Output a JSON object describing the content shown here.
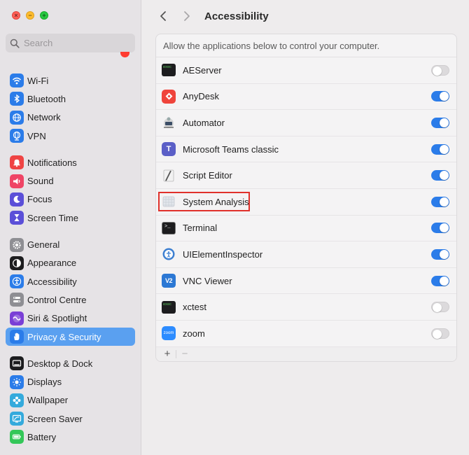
{
  "window": {
    "controls": [
      "×",
      "−",
      "+"
    ]
  },
  "sidebar": {
    "search_placeholder": "Search",
    "groups": [
      [
        {
          "label": "Wi-Fi",
          "icon": "wifi-icon",
          "color": "#2b7ce9"
        },
        {
          "label": "Bluetooth",
          "icon": "bluetooth-icon",
          "color": "#2b7ce9"
        },
        {
          "label": "Network",
          "icon": "globe-icon",
          "color": "#2b7ce9"
        },
        {
          "label": "VPN",
          "icon": "vpn-globe-icon",
          "color": "#2b7ce9"
        }
      ],
      [
        {
          "label": "Notifications",
          "icon": "bell-icon",
          "color": "#ef4444"
        },
        {
          "label": "Sound",
          "icon": "speaker-icon",
          "color": "#ef4465"
        },
        {
          "label": "Focus",
          "icon": "moon-icon",
          "color": "#5b4fd8"
        },
        {
          "label": "Screen Time",
          "icon": "hourglass-icon",
          "color": "#5b4fd8"
        }
      ],
      [
        {
          "label": "General",
          "icon": "gear-icon",
          "color": "#8e8e93"
        },
        {
          "label": "Appearance",
          "icon": "appearance-icon",
          "color": "#1c1c1e"
        },
        {
          "label": "Accessibility",
          "icon": "accessibility-icon",
          "color": "#2b7ce9"
        },
        {
          "label": "Control Centre",
          "icon": "control-centre-icon",
          "color": "#8e8e93"
        },
        {
          "label": "Siri & Spotlight",
          "icon": "siri-icon",
          "color": "#7a3fd6"
        },
        {
          "label": "Privacy & Security",
          "icon": "hand-icon",
          "color": "#2b7ce9",
          "selected": true
        }
      ],
      [
        {
          "label": "Desktop & Dock",
          "icon": "dock-icon",
          "color": "#1c1c1e"
        },
        {
          "label": "Displays",
          "icon": "sun-icon",
          "color": "#2b7ce9"
        },
        {
          "label": "Wallpaper",
          "icon": "flower-icon",
          "color": "#34aadc"
        },
        {
          "label": "Screen Saver",
          "icon": "screensaver-icon",
          "color": "#34aadc"
        },
        {
          "label": "Battery",
          "icon": "battery-icon",
          "color": "#34c759"
        }
      ]
    ]
  },
  "toolbar": {
    "back": "‹",
    "forward": "›",
    "title": "Accessibility"
  },
  "panel": {
    "description": "Allow the applications below to control your computer.",
    "apps": [
      {
        "name": "AEServer",
        "enabled": false,
        "icon": "terminal-exec-icon"
      },
      {
        "name": "AnyDesk",
        "enabled": true,
        "icon": "anydesk-icon"
      },
      {
        "name": "Automator",
        "enabled": true,
        "icon": "automator-icon"
      },
      {
        "name": "Microsoft Teams classic",
        "enabled": true,
        "icon": "teams-icon"
      },
      {
        "name": "Script Editor",
        "enabled": true,
        "icon": "script-editor-icon"
      },
      {
        "name": "System Analysis",
        "enabled": true,
        "icon": "generic-app-icon",
        "highlighted": true
      },
      {
        "name": "Terminal",
        "enabled": true,
        "icon": "terminal-icon"
      },
      {
        "name": "UIElementInspector",
        "enabled": true,
        "icon": "inspector-icon"
      },
      {
        "name": "VNC Viewer",
        "enabled": true,
        "icon": "vnc-icon"
      },
      {
        "name": "xctest",
        "enabled": false,
        "icon": "terminal-exec-icon"
      },
      {
        "name": "zoom",
        "enabled": false,
        "icon": "zoom-icon"
      }
    ],
    "footer": {
      "add": "+",
      "remove": "−"
    }
  }
}
